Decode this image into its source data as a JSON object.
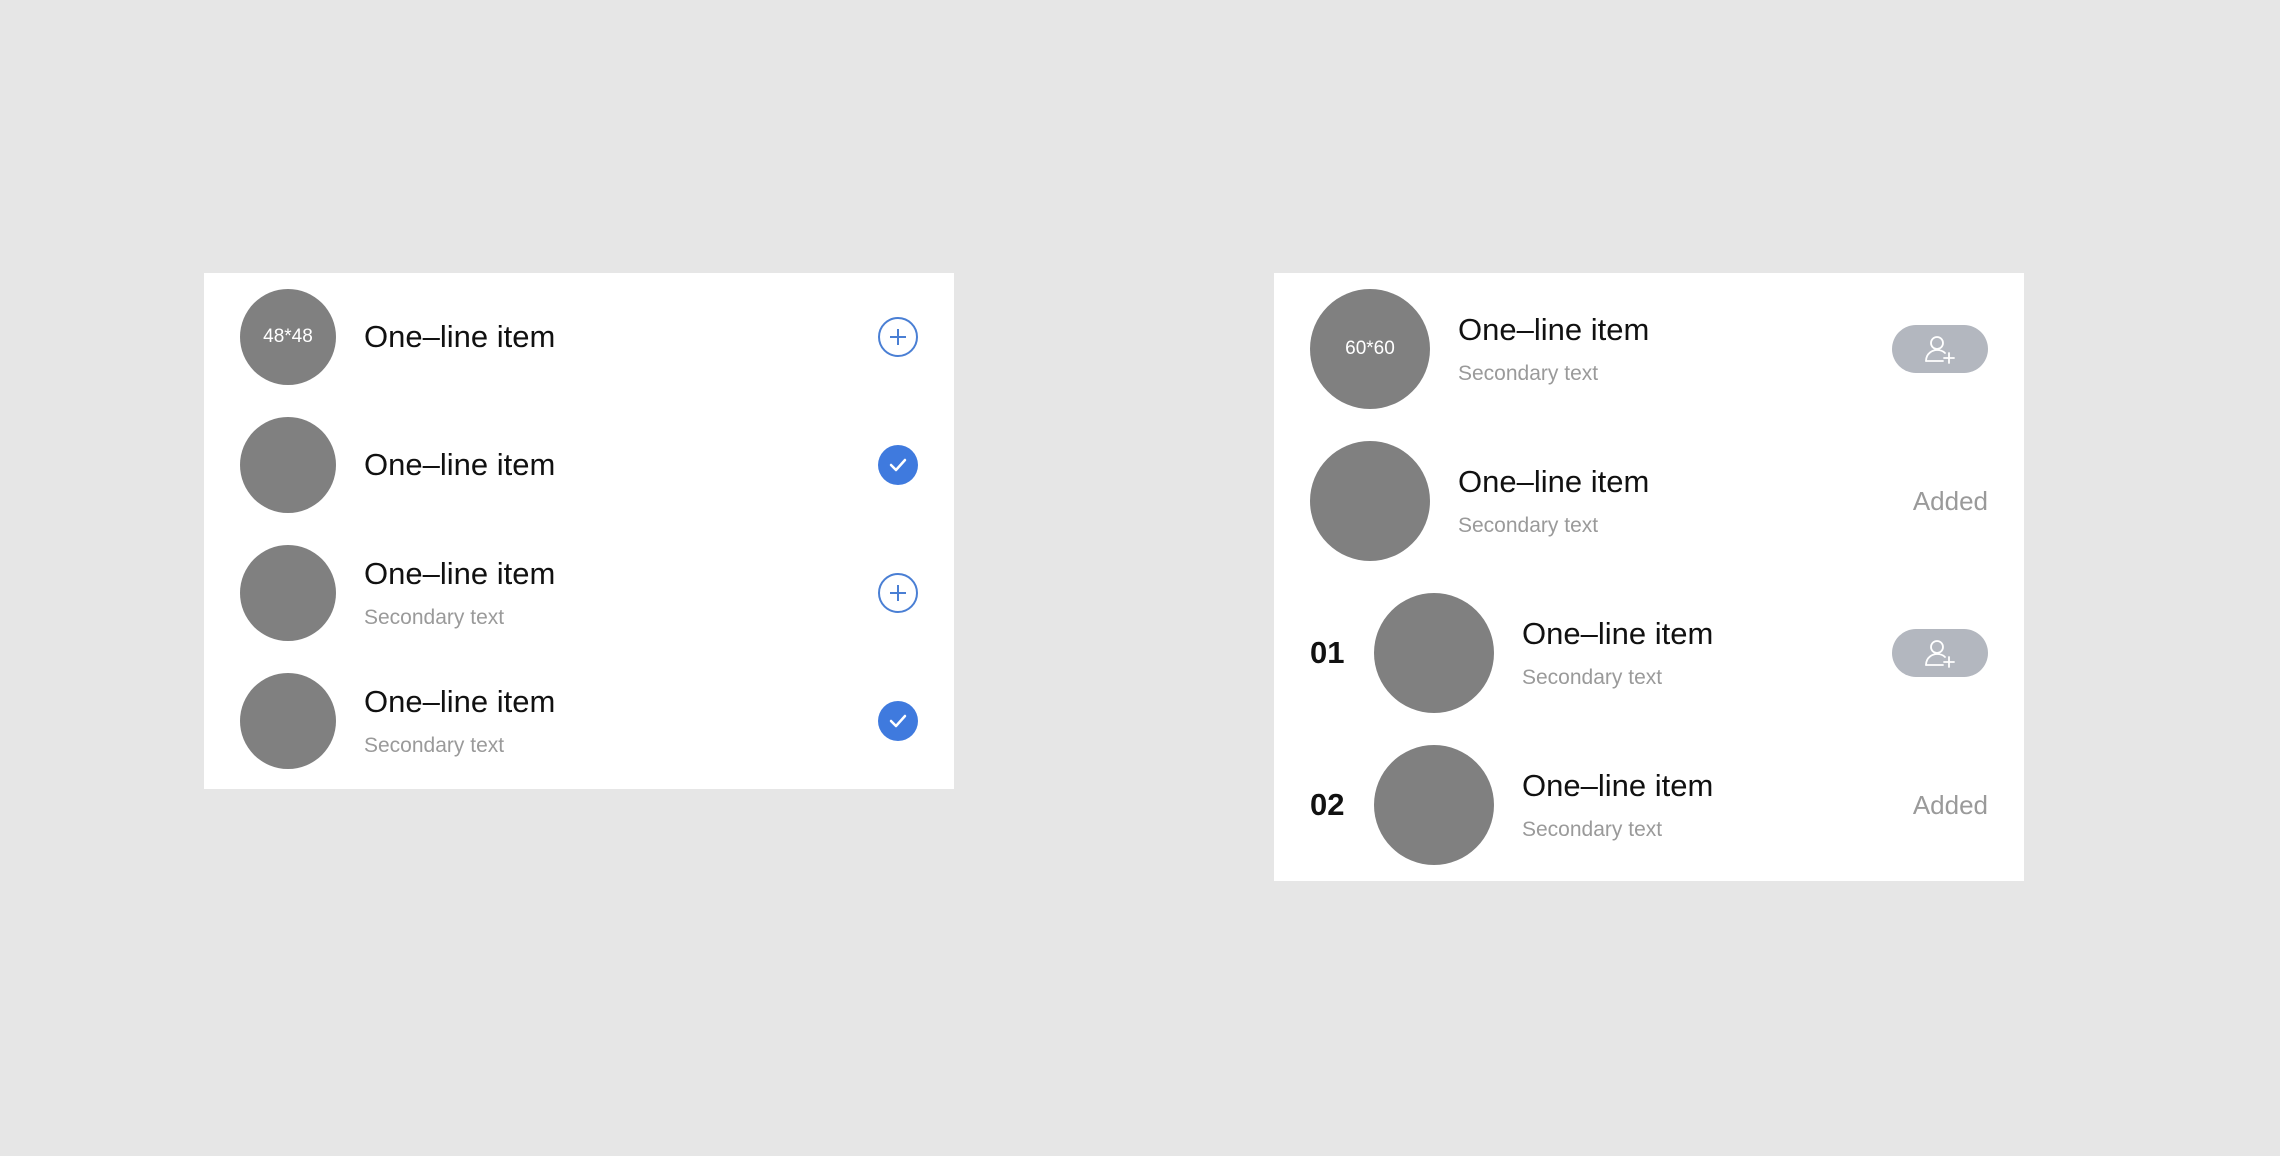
{
  "left_list": {
    "items": [
      {
        "avatar_label": "48*48",
        "title": "One–line item",
        "secondary": "",
        "action": "add"
      },
      {
        "avatar_label": "",
        "title": "One–line item",
        "secondary": "",
        "action": "checked"
      },
      {
        "avatar_label": "",
        "title": "One–line item",
        "secondary": "Secondary text",
        "action": "add"
      },
      {
        "avatar_label": "",
        "title": "One–line item",
        "secondary": "Secondary text",
        "action": "checked"
      }
    ]
  },
  "right_list": {
    "items": [
      {
        "rank": "",
        "avatar_label": "60*60",
        "title": "One–line item",
        "secondary": "Secondary text",
        "action": "add-friend-button"
      },
      {
        "rank": "",
        "avatar_label": "",
        "title": "One–line item",
        "secondary": "Secondary text",
        "action": "added",
        "action_label": "Added"
      },
      {
        "rank": "01",
        "avatar_label": "",
        "title": "One–line item",
        "secondary": "Secondary text",
        "action": "add-friend-button"
      },
      {
        "rank": "02",
        "avatar_label": "",
        "title": "One–line item",
        "secondary": "Secondary text",
        "action": "added",
        "action_label": "Added"
      }
    ]
  },
  "colors": {
    "background": "#e6e6e6",
    "avatar": "#808080",
    "accent_blue": "#3f7ade",
    "pill_gray": "#b3b7bf",
    "secondary_text": "#9a9a9a"
  },
  "icons": {
    "add": "plus-circle-icon",
    "checked": "check-circle-icon",
    "add_friend": "user-add-icon"
  }
}
